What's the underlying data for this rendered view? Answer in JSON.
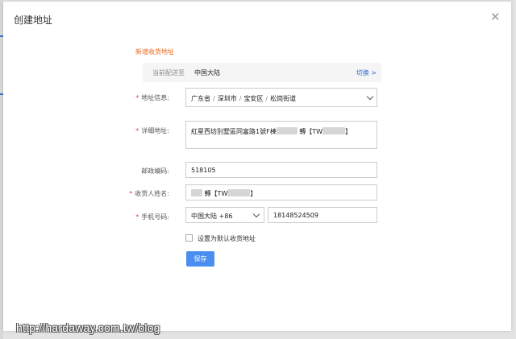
{
  "dialog": {
    "title": "创建地址",
    "close_glyph": "✕"
  },
  "form": {
    "section_title": "新增收货地址",
    "region": {
      "label": "当前配送至",
      "value": "中国大陆",
      "switch_label": "切换 >"
    },
    "address_info": {
      "label": "地址信息:",
      "parts": [
        "广东省",
        "深圳市",
        "宝安区",
        "松岗街道"
      ],
      "separator": "/"
    },
    "detail_address": {
      "label": "详细地址:",
      "value_prefix": "紅星西坊別墅區同富路1號F棟",
      "value_mid": "轉【TW",
      "value_suffix": "】"
    },
    "postal_code": {
      "label": "邮政编码:",
      "value": "518105"
    },
    "recipient": {
      "label": "收货人姓名:",
      "value_mid": "轉【TW",
      "value_suffix": "】"
    },
    "phone": {
      "label": "手机号码:",
      "country_code": "中国大陆 +86",
      "number": "18148524509"
    },
    "default_checkbox": {
      "label": "设置为默认收货地址",
      "checked": false
    },
    "save_label": "保存"
  },
  "watermark": "http://hardaway.com.tw/blog",
  "colors": {
    "accent": "#4a8ff0",
    "section_title": "#e86a1c",
    "required": "#e53e3e",
    "link": "#2b6fd6"
  }
}
